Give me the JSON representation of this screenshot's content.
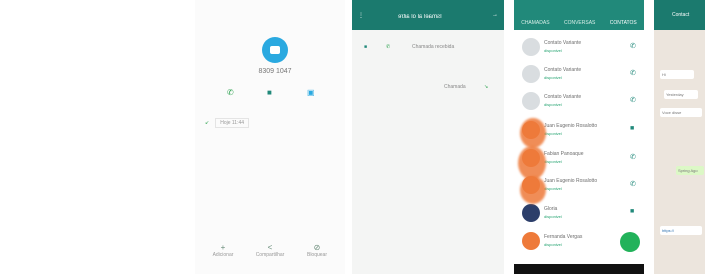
{
  "panel1": {
    "number": "8309 1047",
    "history_text": "Hoje 11:44",
    "bottom_actions": [
      "Adicionar",
      "Compartilhar",
      "Bloquear"
    ]
  },
  "panel2": {
    "title": "Ismael al ol aitre",
    "rows": [
      "Chamada recebida",
      "Chamada"
    ]
  },
  "panel3": {
    "tabs": [
      "CHAMADAS",
      "CONVERSAS",
      "CONTATOS"
    ],
    "contacts": [
      {
        "name": "Contato Variante",
        "status": "disponivel"
      },
      {
        "name": "Contato Variante",
        "status": "disponivel"
      },
      {
        "name": "Contato Variante",
        "status": "disponivel"
      },
      {
        "name": "Juan Eugenio Rosalotto",
        "status": "disponivel"
      },
      {
        "name": "Fabian Panoaque",
        "status": "disponivel"
      },
      {
        "name": "Juan Eugenio Rosalotto",
        "status": "disponivel"
      },
      {
        "name": "Gloria",
        "status": "disponivel"
      },
      {
        "name": "Fernanda Vergas",
        "status": "disponivel"
      }
    ]
  },
  "panel4": {
    "header": "Contact",
    "bubbles": [
      "Hi",
      "Yesterday",
      "Voce disse",
      "Spring Ago",
      "https://"
    ]
  }
}
